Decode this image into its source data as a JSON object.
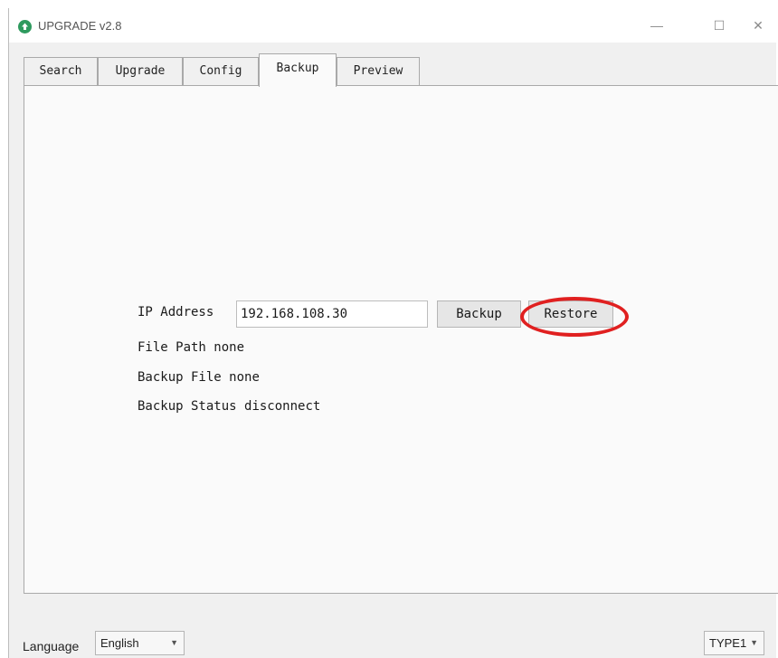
{
  "window": {
    "title": "UPGRADE v2.8",
    "controls": {
      "minimize": "—",
      "maximize": "☐",
      "close": "✕"
    }
  },
  "tabs": [
    {
      "label": "Search",
      "active": false
    },
    {
      "label": "Upgrade",
      "active": false
    },
    {
      "label": "Config",
      "active": false
    },
    {
      "label": "Backup",
      "active": true
    },
    {
      "label": "Preview",
      "active": false
    }
  ],
  "backup_panel": {
    "ip_label": "IP Address",
    "ip_value": "192.168.108.30",
    "backup_button": "Backup",
    "restore_button": "Restore",
    "file_path_label": "File Path",
    "file_path_value": "none",
    "backup_file_label": "Backup File",
    "backup_file_value": "none",
    "status_label": "Backup Status",
    "status_value": "disconnect"
  },
  "footer": {
    "language_label": "Language",
    "language_value": "English",
    "type_value": "TYPE1"
  },
  "colors": {
    "highlight": "#e02020",
    "app_icon": "#2e9a5e"
  }
}
